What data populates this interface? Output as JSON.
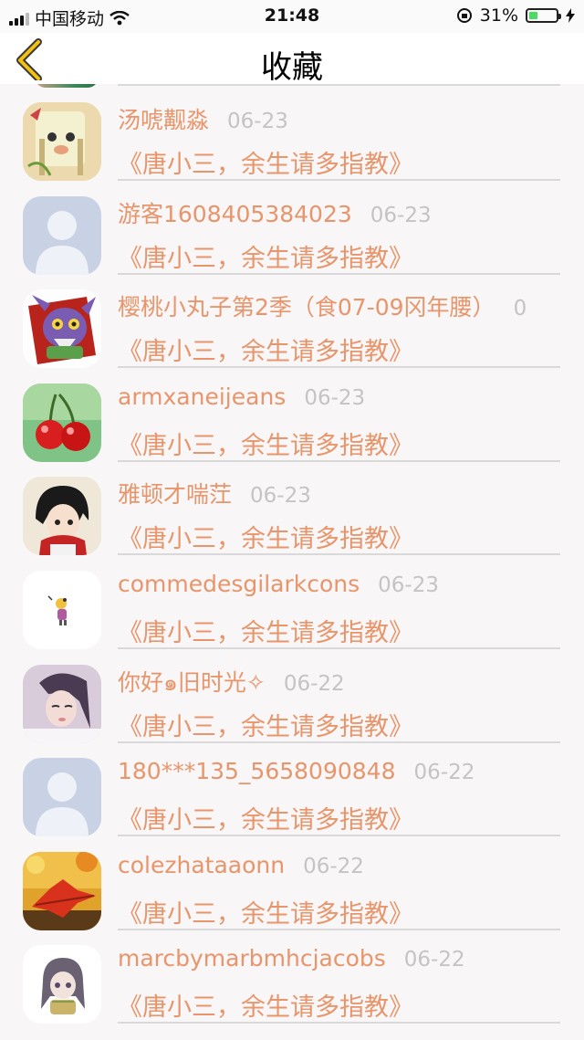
{
  "status_bar": {
    "carrier": "中国移动",
    "time": "21:48",
    "battery_percent": "31%",
    "battery_level": 0.31
  },
  "nav": {
    "title": "收藏",
    "back_icon": "chevron-left-icon",
    "accent_color": "#f3c111"
  },
  "colors": {
    "name": "#e8956b",
    "date": "#c4c4c4"
  },
  "items": [
    {
      "name": "汤唬觏淼",
      "date": "06-23",
      "book": "《唐小三，余生请多指教》",
      "avatar": "cartoon-avatar"
    },
    {
      "name": "游客1608405384023",
      "date": "06-23",
      "book": "《唐小三，余生请多指教》",
      "avatar": "default-user-avatar"
    },
    {
      "name": "樱桃小丸子第2季（食07-09冈年腰）",
      "date": "0",
      "book": "《唐小三，余生请多指教》",
      "avatar": "monster-avatar"
    },
    {
      "name": "armxaneijeans",
      "date": "06-23",
      "book": "《唐小三，余生请多指教》",
      "avatar": "cherry-avatar"
    },
    {
      "name": "雅顿才喘茳",
      "date": "06-23",
      "book": "《唐小三，余生请多指教》",
      "avatar": "anime-avatar"
    },
    {
      "name": "commedesgilarkcons",
      "date": "06-23",
      "book": "《唐小三，余生请多指教》",
      "avatar": "tiny-character-avatar"
    },
    {
      "name": "你好๑旧时光✧",
      "date": "06-22",
      "book": "《唐小三，余生请多指教》",
      "avatar": "girl-avatar"
    },
    {
      "name": "180***135_5658090848",
      "date": "06-22",
      "book": "《唐小三，余生请多指教》",
      "avatar": "default-user-avatar"
    },
    {
      "name": "colezhataaonn",
      "date": "06-22",
      "book": "《唐小三，余生请多指教》",
      "avatar": "autumn-leaf-avatar"
    },
    {
      "name": "marcbymarbmhcjacobs",
      "date": "06-22",
      "book": "《唐小三，余生请多指教》",
      "avatar": "doll-avatar"
    }
  ]
}
